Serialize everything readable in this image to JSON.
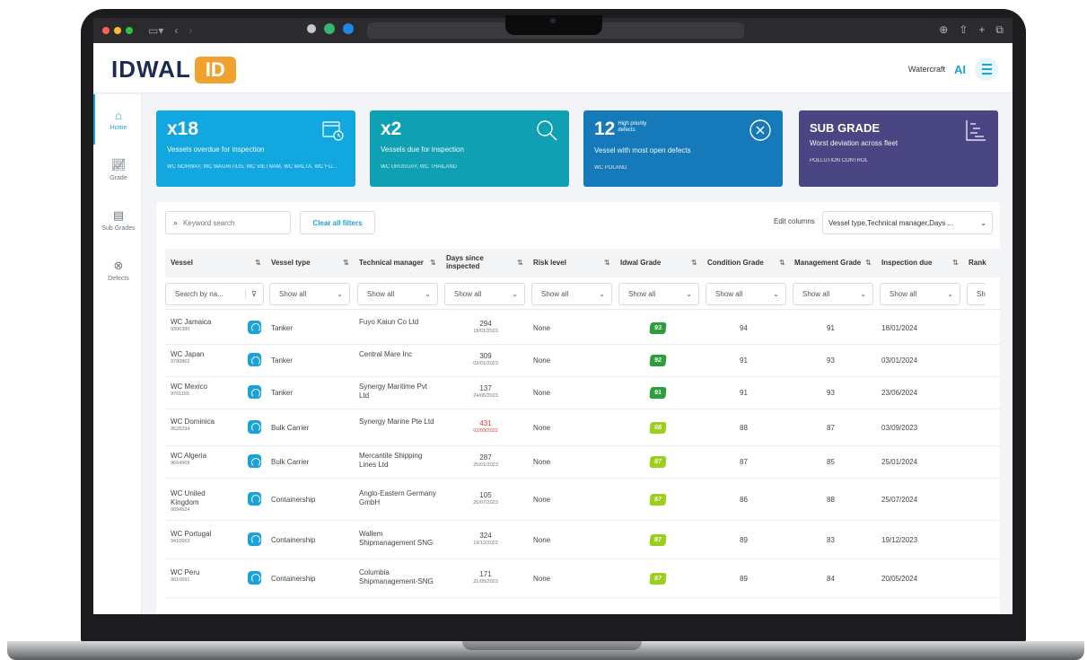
{
  "browser": {
    "traffic_lights": [
      "red",
      "yellow",
      "green"
    ],
    "icons": [
      "sidebar-icon",
      "back-icon",
      "forward-icon"
    ],
    "right_icons": [
      "download-icon",
      "share-icon",
      "new-tab-icon",
      "tabs-icon"
    ]
  },
  "header": {
    "logo_text": "IDWAL",
    "logo_badge": "ID",
    "user": "Watercraft",
    "ai_label": "AI"
  },
  "sidebar": {
    "items": [
      {
        "label": "Home",
        "icon": "home-icon",
        "active": true
      },
      {
        "label": "Grade",
        "icon": "chart-icon",
        "active": false
      },
      {
        "label": "Sub Grades",
        "icon": "subgrades-icon",
        "active": false
      },
      {
        "label": "Defects",
        "icon": "defects-icon",
        "active": false
      }
    ]
  },
  "kpis": [
    {
      "value": "x18",
      "label": "Vessels overdue for inspection",
      "footer": "WC NORWAY, WC MAURITIUS, WC VIETNAM, WC MALTA, WC FIJ...",
      "color": "#12a8df",
      "icon": "calendar-clock-icon"
    },
    {
      "value": "x2",
      "label": "Vessels due for inspection",
      "footer": "WC URUGUAY, WC THAILAND",
      "color": "#0fa1b3",
      "icon": "magnifier-icon"
    },
    {
      "value": "12",
      "small": "High priority defects",
      "label": "Vessel with most open defects",
      "footer": "WC POLAND",
      "color": "#1679b9",
      "icon": "circle-x-icon"
    },
    {
      "value": "SUB GRADE",
      "label": "Worst deviation across fleet",
      "footer": "POLLUTION CONTROL",
      "color": "#4a4683",
      "icon": "subgrade-chart-icon"
    }
  ],
  "toolbar": {
    "search_placeholder": "Keyword search",
    "clear_label": "Clear all filters",
    "edit_columns_label": "Edit columns",
    "columns_value": "Vessel type,Technical manager,Days ..."
  },
  "table": {
    "columns": [
      "Vessel",
      "Vessel type",
      "Technical manager",
      "Days since inspected",
      "Risk level",
      "Idwal Grade",
      "Condition Grade",
      "Management Grade",
      "Inspection due",
      "Rank"
    ],
    "vessel_filter_placeholder": "Search by na...",
    "filter_value": "Show all",
    "filter_truncated": "Sh",
    "rows": [
      {
        "vessel": "WC Jamaica",
        "imo": "9396380",
        "type": "Tanker",
        "manager": "Fuyo Kaiun Co Ltd",
        "days": "294",
        "date": "18/01/2023",
        "overdue": false,
        "risk": "None",
        "idwal": "93",
        "color": "#2e9e3c",
        "condition": "94",
        "management": "91",
        "due": "18/01/2024"
      },
      {
        "vessel": "WC Japan",
        "imo": "9780862",
        "type": "Tanker",
        "manager": "Central Mare Inc",
        "days": "309",
        "date": "03/01/2023",
        "overdue": false,
        "risk": "None",
        "idwal": "92",
        "color": "#2e9e3c",
        "condition": "91",
        "management": "93",
        "due": "03/01/2024"
      },
      {
        "vessel": "WC Mexico",
        "imo": "9761165",
        "type": "Tanker",
        "manager": "Synergy Maritime Pvt Ltd",
        "days": "137",
        "date": "24/06/2023",
        "overdue": false,
        "risk": "None",
        "idwal": "91",
        "color": "#2e9e3c",
        "condition": "91",
        "management": "93",
        "due": "23/06/2024"
      },
      {
        "vessel": "WC Dominica",
        "imo": "9528294",
        "type": "Bulk Carrier",
        "manager": "Synergy Marine Pte Ltd",
        "days": "431",
        "date": "03/09/2022",
        "overdue": true,
        "risk": "None",
        "idwal": "88",
        "color": "#9bcf1d",
        "condition": "88",
        "management": "87",
        "due": "03/09/2023"
      },
      {
        "vessel": "WC Algeria",
        "imo": "9664968",
        "type": "Bulk Carrier",
        "manager": "Mercantile Shipping Lines Ltd",
        "days": "287",
        "date": "25/01/2023",
        "overdue": false,
        "risk": "None",
        "idwal": "87",
        "color": "#9bcf1d",
        "condition": "87",
        "management": "85",
        "due": "25/01/2024"
      },
      {
        "vessel": "WC United Kingdom",
        "imo": "9094524",
        "type": "Containership",
        "manager": "Anglo-Eastern Germany GmbH",
        "days": "105",
        "date": "26/07/2023",
        "overdue": false,
        "risk": "None",
        "idwal": "87",
        "color": "#9bcf1d",
        "condition": "86",
        "management": "88",
        "due": "25/07/2024"
      },
      {
        "vessel": "WC Portugal",
        "imo": "9410663",
        "type": "Containership",
        "manager": "Wallem Shipmanagement SNG",
        "days": "324",
        "date": "19/12/2022",
        "overdue": false,
        "risk": "None",
        "idwal": "87",
        "color": "#9bcf1d",
        "condition": "89",
        "management": "83",
        "due": "19/12/2023"
      },
      {
        "vessel": "WC Peru",
        "imo": "9610691",
        "type": "Containership",
        "manager": "Columbia Shipmanagement-SNG",
        "days": "171",
        "date": "21/05/2023",
        "overdue": false,
        "risk": "None",
        "idwal": "87",
        "color": "#9bcf1d",
        "condition": "89",
        "management": "84",
        "due": "20/05/2024"
      }
    ]
  }
}
